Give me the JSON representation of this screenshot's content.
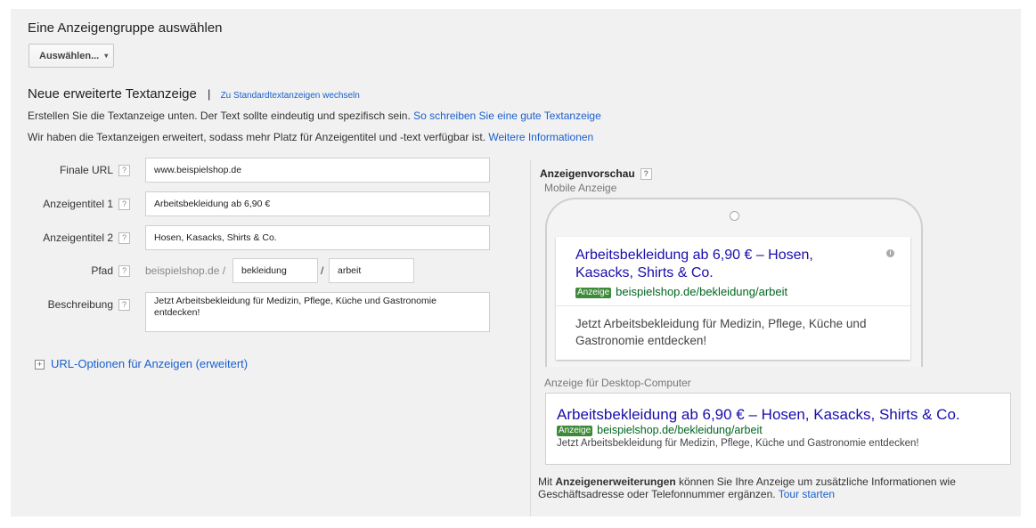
{
  "adgroup": {
    "title": "Eine Anzeigengruppe auswählen",
    "select_label": "Auswählen...",
    "caret": "▾"
  },
  "heading": {
    "title": "Neue erweiterte Textanzeige",
    "separator": "|",
    "switch_link": "Zu Standardtextanzeigen wechseln"
  },
  "intro": {
    "line1_text": "Erstellen Sie die Textanzeige unten. Der Text sollte eindeutig und spezifisch sein.",
    "line1_link": "So schreiben Sie eine gute Textanzeige",
    "line2_text": "Wir haben die Textanzeigen erweitert, sodass mehr Platz für Anzeigentitel und -text verfügbar ist.",
    "line2_link": "Weitere Informationen"
  },
  "form": {
    "help_glyph": "?",
    "final_url": {
      "label": "Finale URL",
      "value": "www.beispielshop.de"
    },
    "headline1": {
      "label": "Anzeigentitel 1",
      "value": "Arbeitsbekleidung ab 6,90 €"
    },
    "headline2": {
      "label": "Anzeigentitel 2",
      "value": "Hosen, Kasacks, Shirts & Co."
    },
    "path": {
      "label": "Pfad",
      "prefix": "beispielshop.de /",
      "path1": "bekleidung",
      "separator": "/",
      "path2": "arbeit"
    },
    "description": {
      "label": "Beschreibung",
      "value": "Jetzt Arbeitsbekleidung für Medizin, Pflege, Küche und Gastronomie entdecken!"
    },
    "url_options": {
      "expander": "+",
      "label": "URL-Optionen für Anzeigen (erweitert)"
    }
  },
  "preview": {
    "title": "Anzeigenvorschau",
    "mobile_label": "Mobile Anzeige",
    "mobile": {
      "headline": "Arbeitsbekleidung ab 6,90 € – Hosen, Kasacks, Shirts & Co.",
      "info_glyph": "i",
      "badge": "Anzeige",
      "display_url": "beispielshop.de/bekleidung/arbeit",
      "description": "Jetzt Arbeitsbekleidung für Medizin, Pflege, Küche und Gastronomie entdecken!"
    },
    "desktop_label": "Anzeige für Desktop-Computer",
    "desktop": {
      "headline": "Arbeitsbekleidung ab 6,90 € – Hosen, Kasacks, Shirts & Co.",
      "badge": "Anzeige",
      "display_url": "beispielshop.de/bekleidung/arbeit",
      "description": "Jetzt Arbeitsbekleidung für Medizin, Pflege, Küche und Gastronomie entdecken!"
    },
    "footer": {
      "prefix": "Mit",
      "bold": "Anzeigenerweiterungen",
      "text": "können Sie Ihre Anzeige um zusätzliche Informationen wie Geschäftsadresse oder Telefonnummer ergänzen.",
      "link": "Tour starten"
    }
  },
  "colors": {
    "panel_bg": "#f1f1f1",
    "link": "#1a5fcc",
    "ad_headline": "#1a0dab",
    "ad_url": "#006621",
    "ad_badge": "#3f8a3a"
  }
}
